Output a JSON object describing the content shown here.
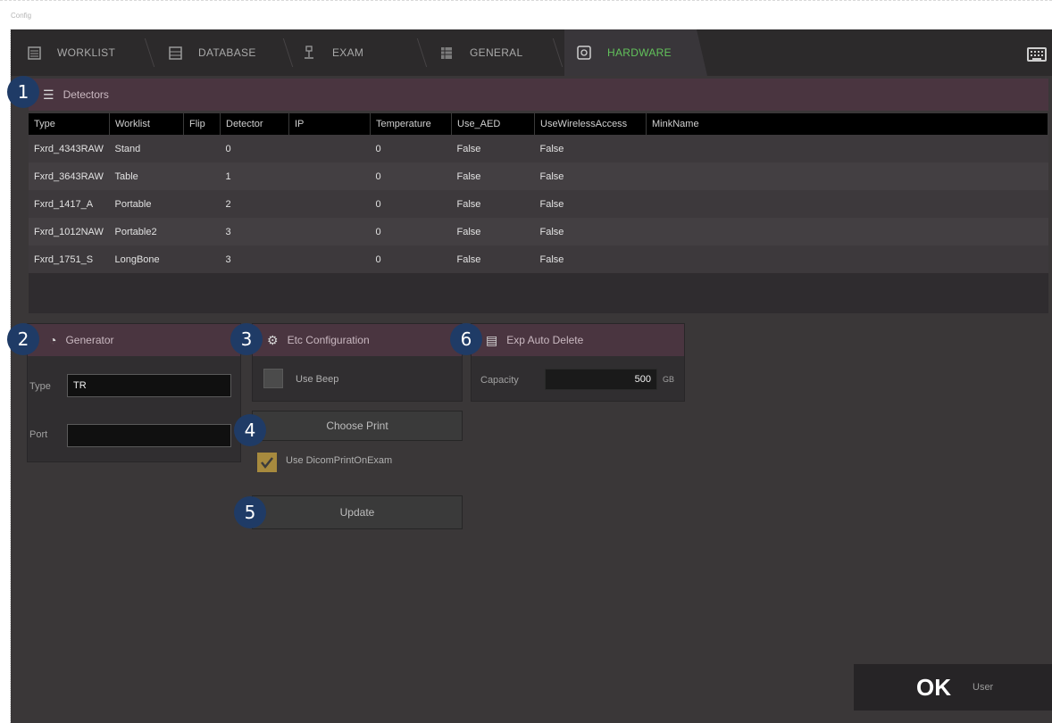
{
  "window": {
    "title": "Config"
  },
  "tabs": [
    {
      "label": "WORKLIST",
      "icon": "list-icon"
    },
    {
      "label": "DATABASE",
      "icon": "database-icon"
    },
    {
      "label": "EXAM",
      "icon": "exam-icon"
    },
    {
      "label": "GENERAL",
      "icon": "grid-icon"
    },
    {
      "label": "HARDWARE",
      "icon": "hardware-icon",
      "active": true
    }
  ],
  "detectors": {
    "title": "Detectors",
    "columns": [
      "Type",
      "Worklist",
      "Flip",
      "Detector",
      "IP",
      "Temperature",
      "Use_AED",
      "UseWirelessAccess",
      "MinkName"
    ],
    "rows": [
      [
        "Fxrd_4343RAW",
        "Stand",
        "",
        "0",
        "",
        "0",
        "False",
        "False",
        ""
      ],
      [
        "Fxrd_3643RAW",
        "Table",
        "",
        "1",
        "",
        "0",
        "False",
        "False",
        ""
      ],
      [
        "Fxrd_1417_A",
        "Portable",
        "",
        "2",
        "",
        "0",
        "False",
        "False",
        ""
      ],
      [
        "Fxrd_1012NAW",
        "Portable2",
        "",
        "3",
        "",
        "0",
        "False",
        "False",
        ""
      ],
      [
        "Fxrd_1751_S",
        "LongBone",
        "",
        "3",
        "",
        "0",
        "False",
        "False",
        ""
      ]
    ]
  },
  "generator": {
    "title": "Generator",
    "type_label": "Type",
    "type_value": "TR",
    "port_label": "Port",
    "port_value": ""
  },
  "etc_configuration": {
    "title": "Etc Configuration",
    "use_beep_label": "Use Beep",
    "use_beep_checked": false,
    "choose_print_label": "Choose Print",
    "use_dicom_print_label": "Use DicomPrintOnExam",
    "use_dicom_print_checked": true,
    "update_label": "Update"
  },
  "auto_delete": {
    "title": "Exp Auto Delete",
    "capacity_label": "Capacity",
    "capacity_value": "500",
    "capacity_unit": "GB"
  },
  "callouts": [
    "1",
    "2",
    "3",
    "4",
    "5",
    "6"
  ],
  "footer": {
    "ok_label": "OK",
    "user_label": "User"
  },
  "colors": {
    "active_tab": "#62c25b",
    "section_header": "#4a3540",
    "callout": "#1f3b66",
    "background": "#3a3738"
  }
}
